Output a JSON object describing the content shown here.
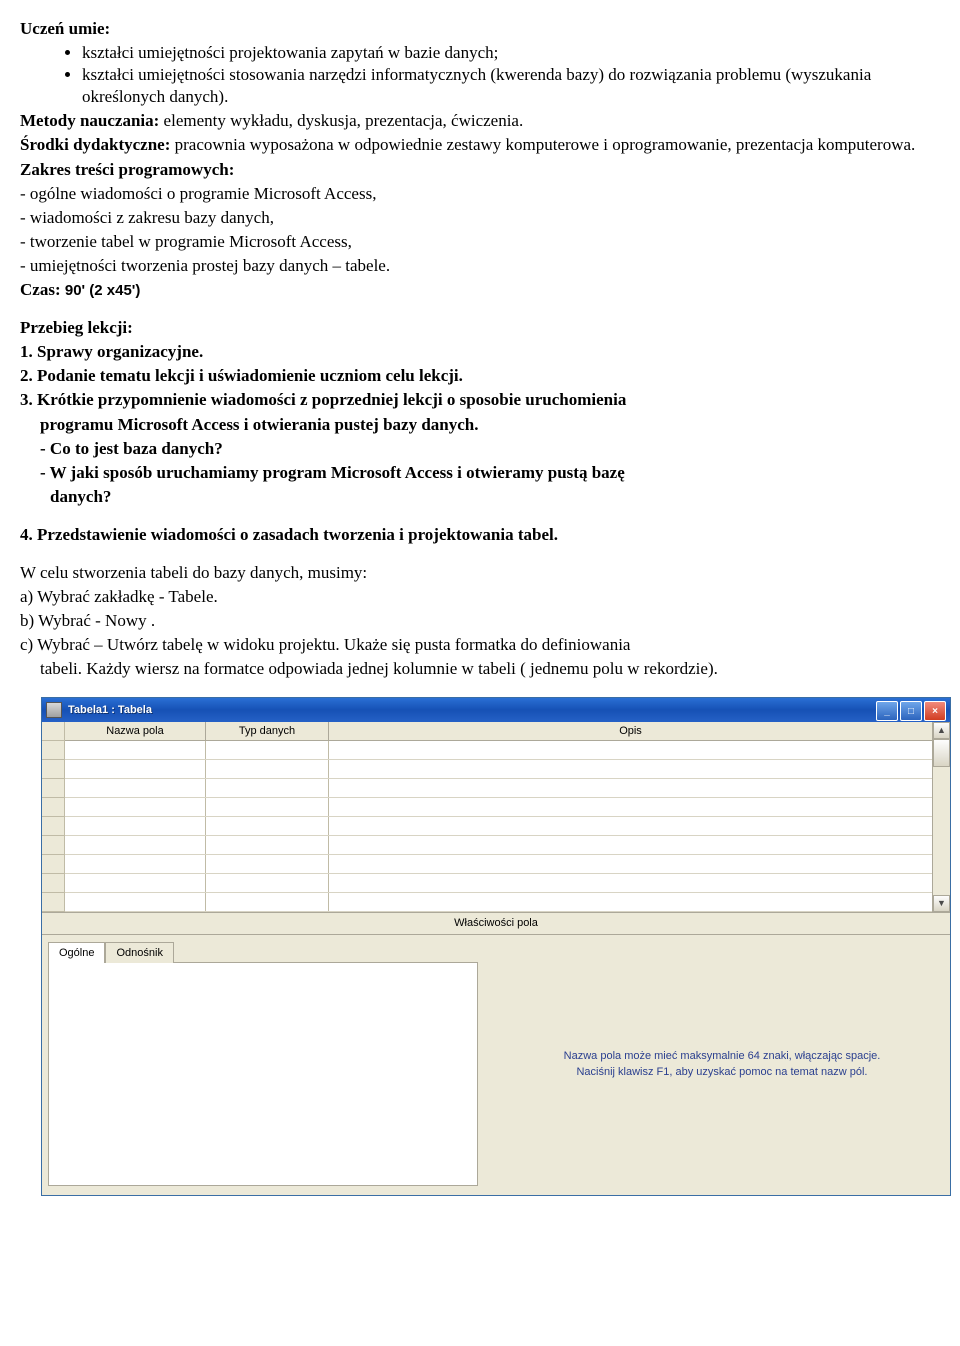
{
  "heading1": "Uczeń umie:",
  "skills": [
    "kształci umiejętności projektowania zapytań w bazie danych;",
    "kształci umiejętności stosowania narzędzi informatycznych (kwerenda bazy) do rozwiązania problemu (wyszukania określonych danych)."
  ],
  "metody_label": "Metody nauczania:",
  "metody_text": " elementy wykładu, dyskusja, prezentacja, ćwiczenia.",
  "srodki_label": "Środki dydaktyczne:",
  "srodki_text": " pracownia wyposażona w odpowiednie zestawy komputerowe i oprogramowanie, prezentacja komputerowa.",
  "zakres_label": "Zakres treści programowych:",
  "zakres_items": [
    "- ogólne wiadomości o programie Microsoft Access,",
    "- wiadomości z zakresu bazy danych,",
    "- tworzenie tabel w programie Microsoft Access,",
    "- umiejętności tworzenia prostej bazy danych – tabele."
  ],
  "czas_label": "Czas: ",
  "czas_val": "90' (2 x45')",
  "przebieg_label": "Przebieg lekcji:",
  "steps": {
    "s1": "1. Sprawy organizacyjne.",
    "s2": "2. Podanie tematu lekcji  i uświadomienie uczniom celu lekcji.",
    "s3a": "3. Krótkie przypomnienie wiadomości z poprzedniej lekcji o sposobie uruchomienia",
    "s3b": "programu Microsoft Access i otwierania pustej bazy danych.",
    "s3q1": "- Co to jest baza danych?",
    "s3q2a": "- W jaki sposób uruchamiamy program Microsoft Access i otwieramy pustą bazę",
    "s3q2b": "danych?",
    "s4": "4. Przedstawienie wiadomości o zasadach tworzenia i projektowania tabel."
  },
  "para_intro": "W celu  stworzenia tabeli do bazy danych, musimy:",
  "para_a": "a) Wybrać zakładkę - Tabele.",
  "para_b": "b)  Wybrać - Nowy .",
  "para_c1": "c) Wybrać – Utwórz tabelę w widoku projektu. Ukaże się pusta formatka do definiowania",
  "para_c2": "tabeli. Każdy wiersz na formatce odpowiada jednej kolumnie w tabeli ( jednemu polu w rekordzie).",
  "access": {
    "title": "Tabela1 : Tabela",
    "cols": {
      "c1": "Nazwa pola",
      "c2": "Typ danych",
      "c3": "Opis"
    },
    "props_label": "Właściwości pola",
    "tab1": "Ogólne",
    "tab2": "Odnośnik",
    "hint1": "Nazwa pola może mieć maksymalnie 64 znaki, włączając spacje.",
    "hint2": "Naciśnij klawisz F1, aby uzyskać pomoc na temat nazw pól."
  }
}
